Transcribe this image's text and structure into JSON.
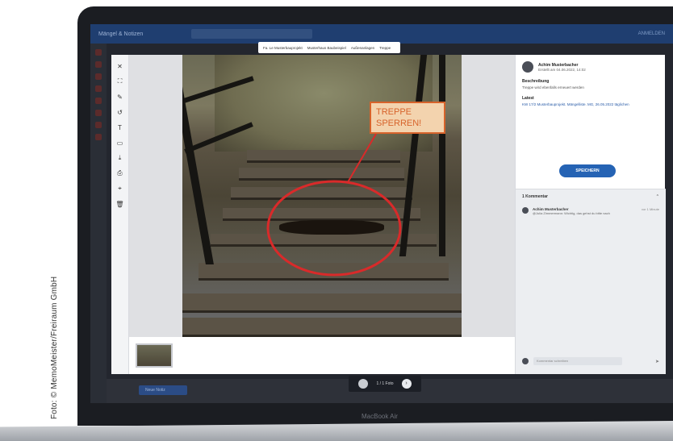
{
  "credit": "Foto: © MemoMeister/Freiraum GmbH",
  "device_label": "MacBook Air",
  "app": {
    "title": "Mängel & Notizen",
    "right_text": "ANMELDEN"
  },
  "breadcrumbs": [
    "Fa. Le Musterbauprojekt",
    "Musterhaus Baubeispiel",
    "Außenanlagen",
    "Treppe"
  ],
  "annotation": {
    "callout_text_line1": "TREPPE",
    "callout_text_line2": "SPERREN!"
  },
  "panel": {
    "user_name": "Achim Musterbacher",
    "user_date": "Erstellt am 04.06.2022, 14:02",
    "description_label": "Beschreibung",
    "description_text": "Treppe wird ebenfalls erneuert werden",
    "deadline_label": "Latest",
    "deadline_text": "KW 17/2 Musterbauprojekt. Mängelliste. MG, 26.05.2022 täglichen",
    "save_label": "SPEICHERN",
    "comments_header": "1 Kommentar",
    "comment": {
      "name": "Achim Musterbacher",
      "text": "@Julia Zimmermann: Wichtig, das gehst du bitte nach",
      "time": "vor 1 Minute"
    },
    "comment_placeholder": "Kommentar schreiben"
  },
  "pager": {
    "label": "1 / 1 Foto"
  },
  "bottom_pill": "Neue Notiz"
}
